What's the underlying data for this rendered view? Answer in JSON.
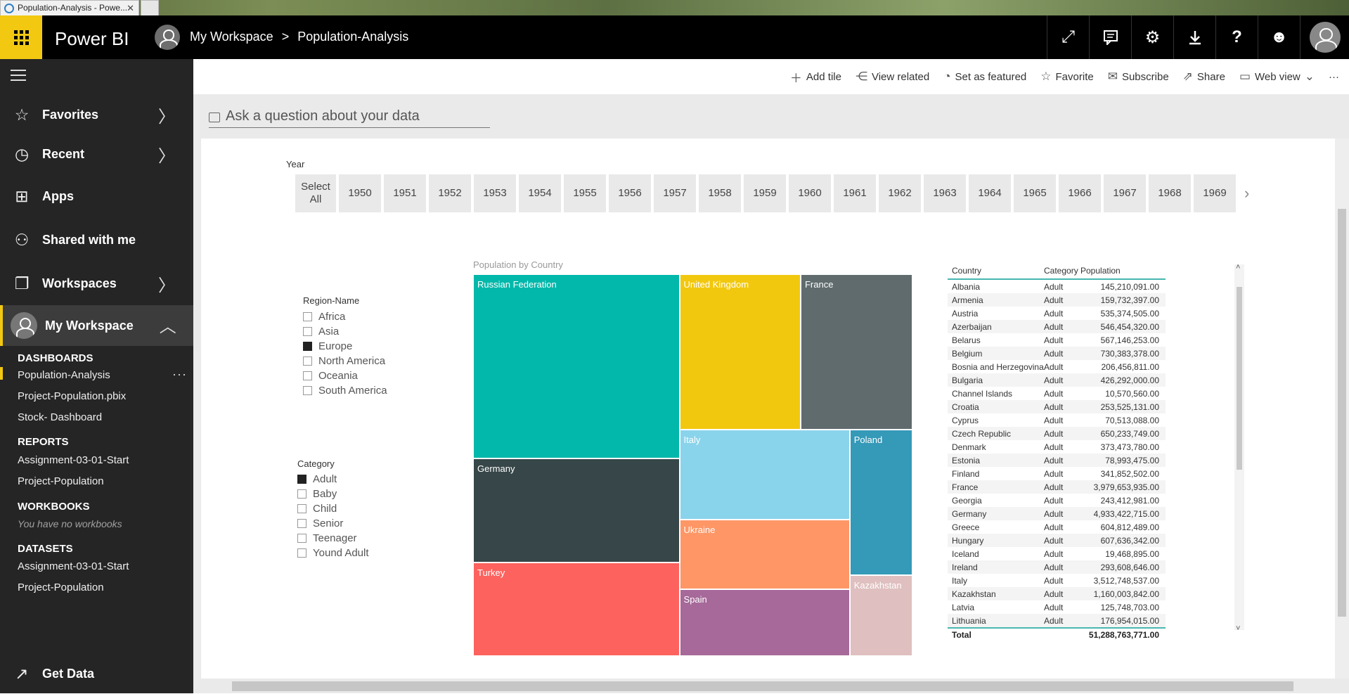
{
  "browser": {
    "tab_title": "Population-Analysis - Powe..."
  },
  "header": {
    "brand": "Power BI",
    "breadcrumb": {
      "workspace": "My Workspace",
      "separator": ">",
      "page": "Population-Analysis"
    },
    "icons": [
      "expand-icon",
      "comment-icon",
      "gear-icon",
      "download-icon",
      "help-icon",
      "smiley-icon",
      "user-avatar-icon"
    ]
  },
  "sidebar": {
    "items": {
      "favorites": "Favorites",
      "recent": "Recent",
      "apps": "Apps",
      "shared": "Shared with me",
      "workspaces": "Workspaces",
      "my_workspace": "My Workspace"
    },
    "dashboards_header": "DASHBOARDS",
    "dashboards": [
      "Population-Analysis",
      "Project-Population.pbix",
      "Stock- Dashboard"
    ],
    "reports_header": "REPORTS",
    "reports": [
      "Assignment-03-01-Start",
      "Project-Population"
    ],
    "workbooks_header": "WORKBOOKS",
    "workbooks_empty": "You have no workbooks",
    "datasets_header": "DATASETS",
    "datasets": [
      "Assignment-03-01-Start",
      "Project-Population"
    ],
    "get_data": "Get Data"
  },
  "commands": {
    "add_tile": "Add tile",
    "view_related": "View related",
    "set_featured": "Set as featured",
    "favorite": "Favorite",
    "subscribe": "Subscribe",
    "share": "Share",
    "web_view": "Web view",
    "more": "···"
  },
  "qa": {
    "placeholder": "Ask a question about your data"
  },
  "year_slicer": {
    "title": "Year",
    "select_all": "Select All",
    "years": [
      "1950",
      "1951",
      "1952",
      "1953",
      "1954",
      "1955",
      "1956",
      "1957",
      "1958",
      "1959",
      "1960",
      "1961",
      "1962",
      "1963",
      "1964",
      "1965",
      "1966",
      "1967",
      "1968",
      "1969"
    ]
  },
  "region_slicer": {
    "title": "Region-Name",
    "items": [
      {
        "label": "Africa",
        "checked": false
      },
      {
        "label": "Asia",
        "checked": false
      },
      {
        "label": "Europe",
        "checked": true
      },
      {
        "label": "North America",
        "checked": false
      },
      {
        "label": "Oceania",
        "checked": false
      },
      {
        "label": "South America",
        "checked": false
      }
    ]
  },
  "category_slicer": {
    "title": "Category",
    "items": [
      {
        "label": "Adult",
        "checked": true
      },
      {
        "label": "Baby",
        "checked": false
      },
      {
        "label": "Child",
        "checked": false
      },
      {
        "label": "Senior",
        "checked": false
      },
      {
        "label": "Teenager",
        "checked": false
      },
      {
        "label": "Yound Adult",
        "checked": false
      }
    ]
  },
  "treemap": {
    "title": "Population by Country",
    "tiles": [
      {
        "label": "Russian Federation",
        "color": "#01b8aa"
      },
      {
        "label": "United Kingdom",
        "color": "#f2c80f"
      },
      {
        "label": "France",
        "color": "#5f6b6d"
      },
      {
        "label": "Germany",
        "color": "#374649"
      },
      {
        "label": "Italy",
        "color": "#8ad4eb"
      },
      {
        "label": "Poland",
        "color": "#3599b8"
      },
      {
        "label": "Ukraine",
        "color": "#fe9666"
      },
      {
        "label": "Turkey",
        "color": "#fd625e"
      },
      {
        "label": "Spain",
        "color": "#a66999"
      },
      {
        "label": "Kazakhstan",
        "color": "#dfbfbf"
      }
    ]
  },
  "table": {
    "headers": [
      "Country",
      "Category",
      "Population"
    ],
    "rows": [
      [
        "Albania",
        "Adult",
        "145,210,091.00"
      ],
      [
        "Armenia",
        "Adult",
        "159,732,397.00"
      ],
      [
        "Austria",
        "Adult",
        "535,374,505.00"
      ],
      [
        "Azerbaijan",
        "Adult",
        "546,454,320.00"
      ],
      [
        "Belarus",
        "Adult",
        "567,146,253.00"
      ],
      [
        "Belgium",
        "Adult",
        "730,383,378.00"
      ],
      [
        "Bosnia and Herzegovina",
        "Adult",
        "206,456,811.00"
      ],
      [
        "Bulgaria",
        "Adult",
        "426,292,000.00"
      ],
      [
        "Channel Islands",
        "Adult",
        "10,570,560.00"
      ],
      [
        "Croatia",
        "Adult",
        "253,525,131.00"
      ],
      [
        "Cyprus",
        "Adult",
        "70,513,088.00"
      ],
      [
        "Czech Republic",
        "Adult",
        "650,233,749.00"
      ],
      [
        "Denmark",
        "Adult",
        "373,473,780.00"
      ],
      [
        "Estonia",
        "Adult",
        "78,993,475.00"
      ],
      [
        "Finland",
        "Adult",
        "341,852,502.00"
      ],
      [
        "France",
        "Adult",
        "3,979,653,935.00"
      ],
      [
        "Georgia",
        "Adult",
        "243,412,981.00"
      ],
      [
        "Germany",
        "Adult",
        "4,933,422,715.00"
      ],
      [
        "Greece",
        "Adult",
        "604,812,489.00"
      ],
      [
        "Hungary",
        "Adult",
        "607,636,342.00"
      ],
      [
        "Iceland",
        "Adult",
        "19,468,895.00"
      ],
      [
        "Ireland",
        "Adult",
        "293,608,646.00"
      ],
      [
        "Italy",
        "Adult",
        "3,512,748,537.00"
      ],
      [
        "Kazakhstan",
        "Adult",
        "1,160,003,842.00"
      ],
      [
        "Latvia",
        "Adult",
        "125,748,703.00"
      ],
      [
        "Lithuania",
        "Adult",
        "176,954,015.00"
      ]
    ],
    "total_label": "Total",
    "total_value": "51,288,763,771.00"
  }
}
